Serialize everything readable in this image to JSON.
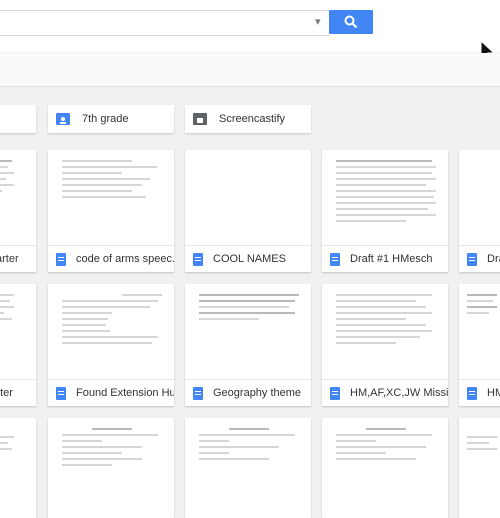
{
  "folders": [
    {
      "label": "7th grade",
      "icon": "shared-folder-icon",
      "color": "#4285f4"
    },
    {
      "label": "Screencastify",
      "icon": "folder-icon",
      "color": "#5f6368"
    }
  ],
  "files": [
    {
      "label": "arter"
    },
    {
      "label": "code of arms speec..."
    },
    {
      "label": "COOL NAMES"
    },
    {
      "label": "Draft #1 HMesch"
    },
    {
      "label": "Dra"
    },
    {
      "label": "nter"
    },
    {
      "label": "Found Extension Hu..."
    },
    {
      "label": "Geography theme"
    },
    {
      "label": "HM,AF,XC,JW Missi..."
    },
    {
      "label": "HM"
    }
  ],
  "colors": {
    "accent": "#4285f4",
    "doc_icon": "#4285f4"
  }
}
